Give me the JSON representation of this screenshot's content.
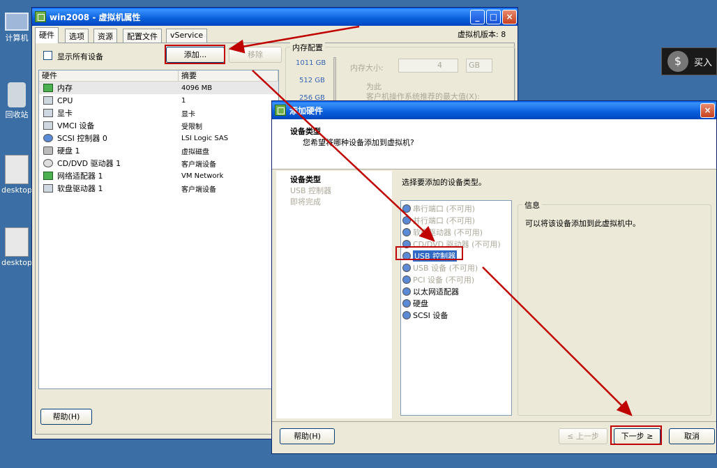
{
  "desktop": {
    "icons": [
      {
        "label": "计算机"
      },
      {
        "label": "回收站"
      },
      {
        "label": "desktop"
      },
      {
        "label": "desktop"
      }
    ],
    "buy_label": "买入"
  },
  "vm_window": {
    "title": "win2008 - 虚拟机属性",
    "tabs": [
      "硬件",
      "选项",
      "资源",
      "配置文件",
      "vService"
    ],
    "vm_version": "虚拟机版本: 8",
    "show_all_label": "显示所有设备",
    "add_button": "添加...",
    "remove_button": "移除",
    "columns": [
      "硬件",
      "摘要"
    ],
    "hardware": [
      {
        "name": "内存",
        "summary": "4096 MB",
        "icon": "memory-icon"
      },
      {
        "name": "CPU",
        "summary": "1",
        "icon": "cpu-icon"
      },
      {
        "name": "显卡",
        "summary": "显卡",
        "icon": "display-icon"
      },
      {
        "name": "VMCI 设备",
        "summary": "受限制",
        "icon": "vmci-icon"
      },
      {
        "name": "SCSI 控制器 0",
        "summary": "LSI Logic SAS",
        "icon": "scsi-icon"
      },
      {
        "name": "硬盘 1",
        "summary": "虚拟磁盘",
        "icon": "disk-icon"
      },
      {
        "name": "CD/DVD 驱动器 1",
        "summary": "客户端设备",
        "icon": "cd-icon"
      },
      {
        "name": "网络适配器 1",
        "summary": "VM Network",
        "icon": "network-icon"
      },
      {
        "name": "软盘驱动器 1",
        "summary": "客户端设备",
        "icon": "floppy-icon"
      }
    ],
    "memory_group": "内存配置",
    "memory_ticks": [
      "1011 GB",
      "512 GB",
      "256 GB"
    ],
    "memory_size_label": "内存大小:",
    "memory_size_value": "4",
    "memory_unit": "GB",
    "recommend_text1": "为此",
    "recommend_text2": "客户机操作系统推荐的最大值(X):",
    "help_button": "帮助(H)"
  },
  "add_dialog": {
    "title": "添加硬件",
    "header_title": "设备类型",
    "header_sub": "您希望将哪种设备添加到虚拟机?",
    "steps": [
      "设备类型",
      "USB 控制器",
      "即将完成"
    ],
    "prompt": "选择要添加的设备类型。",
    "devices": [
      {
        "label": "串行端口 (不可用)",
        "enabled": false
      },
      {
        "label": "并行端口 (不可用)",
        "enabled": false
      },
      {
        "label": "软盘驱动器 (不可用)",
        "enabled": false
      },
      {
        "label": "CD/DVD 驱动器 (不可用)",
        "enabled": false
      },
      {
        "label": "USB 控制器",
        "enabled": true,
        "selected": true
      },
      {
        "label": "USB 设备 (不可用)",
        "enabled": false
      },
      {
        "label": "PCI 设备 (不可用)",
        "enabled": false
      },
      {
        "label": "以太网适配器",
        "enabled": true
      },
      {
        "label": "硬盘",
        "enabled": true
      },
      {
        "label": "SCSI 设备",
        "enabled": true
      }
    ],
    "info_group": "信息",
    "info_text": "可以将该设备添加到此虚拟机中。",
    "help_button": "帮助(H)",
    "back_button": "≤ 上一步",
    "next_button": "下一步 ≥",
    "cancel_button": "取消"
  },
  "annotation_color": "#c00000"
}
